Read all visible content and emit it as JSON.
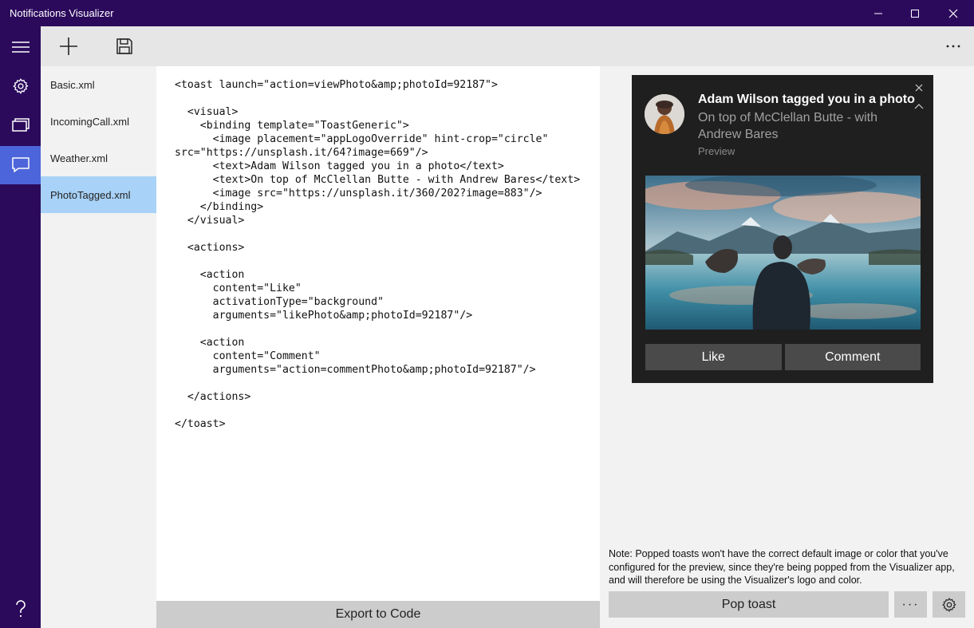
{
  "window": {
    "title": "Notifications Visualizer"
  },
  "files": [
    {
      "label": "Basic.xml"
    },
    {
      "label": "IncomingCall.xml"
    },
    {
      "label": "Weather.xml"
    },
    {
      "label": "PhotoTagged.xml"
    }
  ],
  "editor": {
    "xml": "<toast launch=\"action=viewPhoto&amp;photoId=92187\">\n\n  <visual>\n    <binding template=\"ToastGeneric\">\n      <image placement=\"appLogoOverride\" hint-crop=\"circle\"\nsrc=\"https://unsplash.it/64?image=669\"/>\n      <text>Adam Wilson tagged you in a photo</text>\n      <text>On top of McClellan Butte - with Andrew Bares</text>\n      <image src=\"https://unsplash.it/360/202?image=883\"/>\n    </binding>\n  </visual>\n\n  <actions>\n\n    <action\n      content=\"Like\"\n      activationType=\"background\"\n      arguments=\"likePhoto&amp;photoId=92187\"/>\n\n    <action\n      content=\"Comment\"\n      arguments=\"action=commentPhoto&amp;photoId=92187\"/>\n\n  </actions>\n\n</toast>",
    "export_label": "Export to Code"
  },
  "toast": {
    "title": "Adam Wilson tagged you in a photo",
    "body": "On top of McClellan Butte - with Andrew Bares",
    "attribution": "Preview",
    "actions": [
      "Like",
      "Comment"
    ]
  },
  "preview": {
    "note": "Note: Popped toasts won't have the correct default image or color that you've configured for the preview, since they're being popped from the Visualizer app, and will therefore be using the Visualizer's logo and color.",
    "pop_label": "Pop toast",
    "more_label": "···"
  },
  "colors": {
    "accent": "#2b0a5c",
    "nav_active": "#4d65da",
    "selected_item": "#a8d2f7",
    "toast_bg": "#1f1f1f"
  },
  "icons": {
    "nav": [
      "hamburger-icon",
      "settings-icon",
      "slides-icon",
      "message-icon",
      "help-icon"
    ],
    "toolbar": [
      "add-icon",
      "save-icon",
      "more-icon"
    ]
  }
}
